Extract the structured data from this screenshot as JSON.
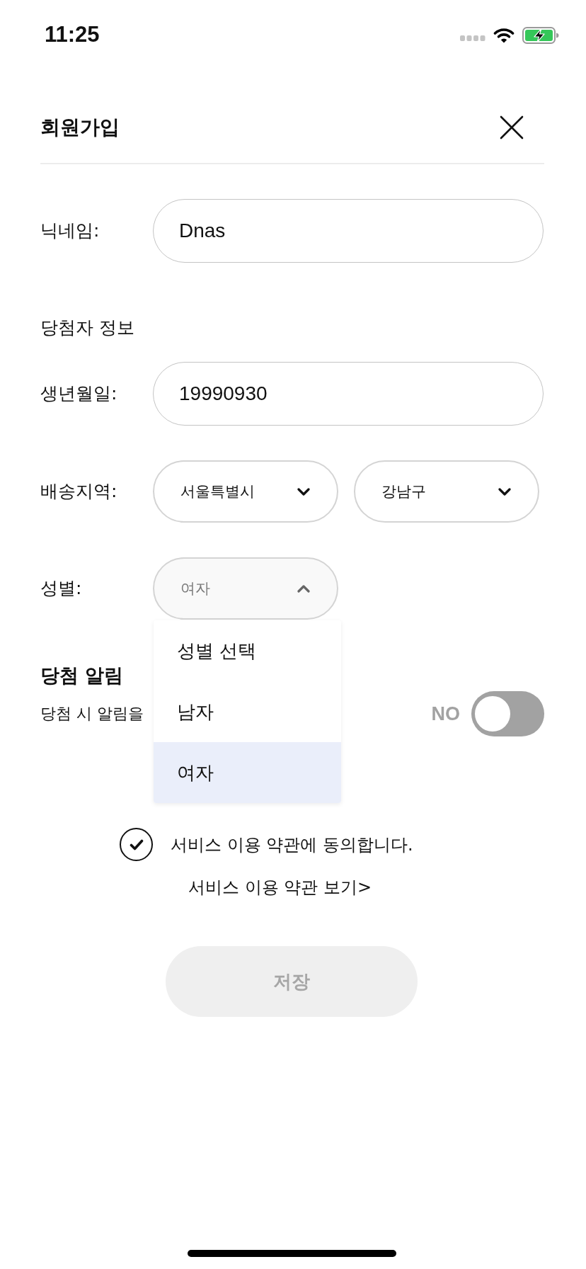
{
  "status_bar": {
    "time": "11:25"
  },
  "header": {
    "title": "회원가입"
  },
  "form": {
    "rows": [
      {
        "kind": "input",
        "label": "닉네임:",
        "value": "Dnas"
      },
      {
        "kind": "heading",
        "label": "당첨자 정보"
      },
      {
        "kind": "input",
        "label": "생년월일:",
        "value": "19990930"
      },
      {
        "kind": "selects",
        "label": "배송지역:",
        "selects": [
          {
            "value": "서울특별시",
            "expanded": false
          },
          {
            "value": "강남구",
            "expanded": false
          }
        ]
      },
      {
        "kind": "selects",
        "label": "성별:",
        "selects": [
          {
            "value": "여자",
            "expanded": true,
            "options": [
              {
                "label": "성별 선택",
                "selected": false
              },
              {
                "label": "남자",
                "selected": false
              },
              {
                "label": "여자",
                "selected": true
              }
            ]
          }
        ]
      }
    ]
  },
  "notification": {
    "title": "당첨 알림",
    "description": "당첨 시 알림을",
    "toggle": {
      "label": "NO",
      "on": false
    }
  },
  "terms": {
    "checked": true,
    "agree_text": "서비스 이용 약관에 동의합니다.",
    "link": "서비스 이용 약관 보기>"
  },
  "save_button": {
    "label": "저장",
    "disabled": true
  }
}
